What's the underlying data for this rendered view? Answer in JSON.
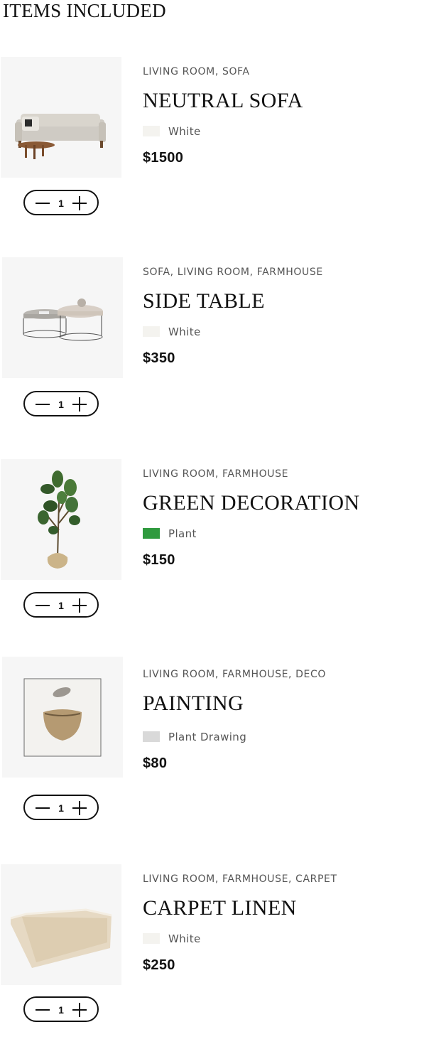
{
  "section": {
    "title": "ITEMS INCLUDED"
  },
  "items": [
    {
      "categories": "LIVING ROOM, SOFA",
      "name": "NEUTRAL SOFA",
      "color_name": "White",
      "color_hex": "#f4f3ef",
      "price": "$1500",
      "quantity": "1",
      "image": "sofa-image"
    },
    {
      "categories": "SOFA, LIVING ROOM, FARMHOUSE",
      "name": "SIDE TABLE",
      "color_name": "White",
      "color_hex": "#f4f3ef",
      "price": "$350",
      "quantity": "1",
      "image": "side-table-image"
    },
    {
      "categories": "LIVING ROOM, FARMHOUSE",
      "name": "GREEN DECORATION",
      "color_name": "Plant",
      "color_hex": "#2f9a3e",
      "price": "$150",
      "quantity": "1",
      "image": "plant-image"
    },
    {
      "categories": "LIVING ROOM, FARMHOUSE, DECO",
      "name": "PAINTING",
      "color_name": "Plant Drawing",
      "color_hex": "#d9d9d9",
      "price": "$80",
      "quantity": "1",
      "image": "painting-image"
    },
    {
      "categories": "LIVING ROOM, FARMHOUSE, CARPET",
      "name": "CARPET LINEN",
      "color_name": "White",
      "color_hex": "#f4f3ef",
      "price": "$250",
      "quantity": "1",
      "image": "carpet-image"
    }
  ]
}
